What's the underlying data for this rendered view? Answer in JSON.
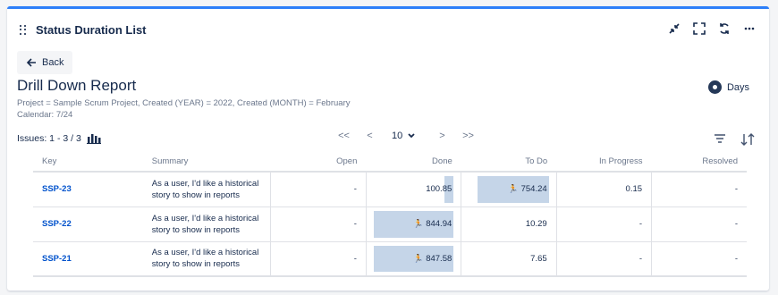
{
  "gadget": {
    "title": "Status Duration List"
  },
  "header_actions": [
    "minimize-icon",
    "fullscreen-icon",
    "refresh-icon",
    "more-icon"
  ],
  "back": {
    "label": "Back"
  },
  "report": {
    "title": "Drill Down Report",
    "filter_line": "Project = Sample Scrum Project, Created (YEAR) = 2022, Created (MONTH) = February",
    "calendar_line": "Calendar: 7/24"
  },
  "unit_toggle": {
    "label": "Days"
  },
  "issues": {
    "label": "Issues: 1 - 3 / 3"
  },
  "pagination": {
    "first": "<<",
    "prev": "<",
    "page_size": "10",
    "next": ">",
    "last": ">>"
  },
  "table": {
    "columns": [
      "Key",
      "Summary",
      "Open",
      "Done",
      "To Do",
      "In Progress",
      "Resolved"
    ],
    "rows": [
      {
        "key": "SSP-23",
        "summary_1": "As a user, I'd like a historical",
        "summary_2": "story to show in reports",
        "open": "-",
        "done": "100.85",
        "todo": "754.24",
        "in_progress": "0.15",
        "resolved": "-",
        "done_fill": 0.11,
        "todo_fill": 0.89,
        "todo_runner": true,
        "done_runner": false
      },
      {
        "key": "SSP-22",
        "summary_1": "As a user, I'd like a historical",
        "summary_2": "story to show in reports",
        "open": "-",
        "done": "844.94",
        "todo": "10.29",
        "in_progress": "-",
        "resolved": "-",
        "done_fill": 1.0,
        "todo_fill": 0,
        "todo_runner": false,
        "done_runner": true
      },
      {
        "key": "SSP-21",
        "summary_1": "As a user, I'd like a historical",
        "summary_2": "story to show in reports",
        "open": "-",
        "done": "847.58",
        "todo": "7.65",
        "in_progress": "-",
        "resolved": "-",
        "done_fill": 1.0,
        "todo_fill": 0,
        "todo_runner": false,
        "done_runner": true
      }
    ]
  },
  "runner_glyph": "🏃"
}
